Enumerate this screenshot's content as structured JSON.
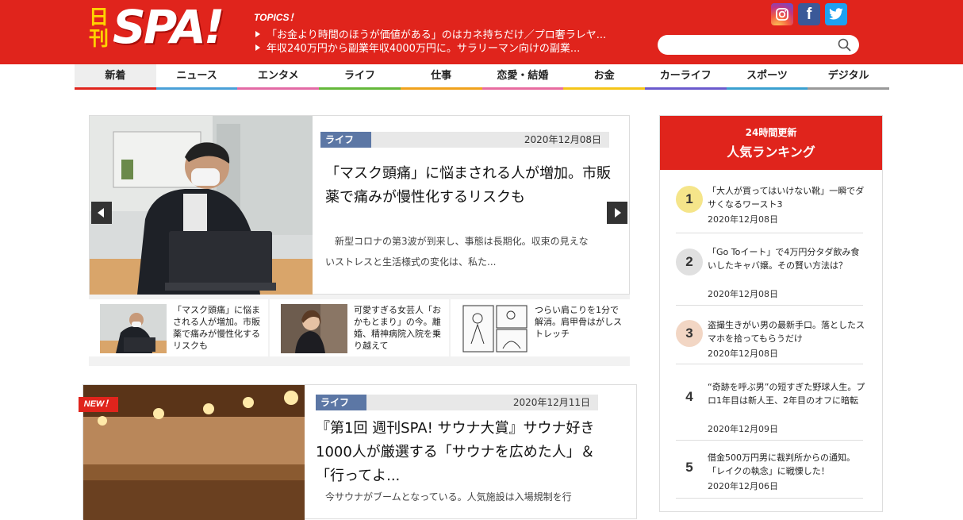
{
  "header": {
    "logo_kanji": "日刊",
    "logo_text": "SPA!",
    "topics_label": "TOPICS！",
    "topics": [
      "「お金より時間のほうが価値がある」のはカネ持ちだけ／プロ奢ラレヤ...",
      "年収240万円から副業年収4000万円に。サラリーマン向けの副業..."
    ],
    "search_placeholder": "",
    "social": [
      "instagram-icon",
      "facebook-icon",
      "twitter-icon"
    ]
  },
  "nav": {
    "items": [
      "新着",
      "ニュース",
      "エンタメ",
      "ライフ",
      "仕事",
      "恋愛・結婚",
      "お金",
      "カーライフ",
      "スポーツ",
      "デジタル"
    ],
    "colors": [
      "#e0241c",
      "#4aa0d8",
      "#e36aa5",
      "#64b83a",
      "#f0a21c",
      "#e86ca0",
      "#f5c518",
      "#6a5acd",
      "#3aa0d0",
      "#999999"
    ]
  },
  "feature": {
    "category": "ライフ",
    "date": "2020年12月08日",
    "headline": "「マスク頭痛」に悩まされる人が増加。市販薬で痛みが慢性化するリスクも",
    "excerpt": "新型コロナの第3波が到来し、事態は長期化。収束の見えないストレスと生活様式の変化は、私た..."
  },
  "thumbs": [
    {
      "text": "「マスク頭痛」に悩まされる人が増加。市販薬で痛みが慢性化するリスクも"
    },
    {
      "text": "可愛すぎる女芸人「おかもとまり」の今。離婚、精神病院入院を乗り越えて"
    },
    {
      "text": "つらい肩こりを1分で解消。肩甲骨はがしストレッチ"
    }
  ],
  "second": {
    "new_badge": "NEW！",
    "category": "ライフ",
    "date": "2020年12月11日",
    "headline": "『第1回 週刊SPA! サウナ大賞』サウナ好き1000人が厳選する「サウナを広めた人」＆「行ってよ...",
    "excerpt": "今サウナがブームとなっている。人気施設は入場規制を行"
  },
  "ranking": {
    "subtitle": "24時間更新",
    "title": "人気ランキング",
    "items": [
      {
        "num": "1",
        "title": "「大人が買ってはいけない靴」一瞬でダサくなるワースト3",
        "date": "2020年12月08日"
      },
      {
        "num": "2",
        "title": "「Go Toイート」で4万円分タダ飲み食いしたキャバ嬢。その賢い方法は？",
        "date": "2020年12月08日"
      },
      {
        "num": "3",
        "title": "盗撮生きがい男の最新手口。落としたスマホを拾ってもらうだけ",
        "date": "2020年12月08日"
      },
      {
        "num": "4",
        "title": "“奇跡を呼ぶ男”の短すぎた野球人生。プロ1年目は新人王、2年目のオフに暗転",
        "date": "2020年12月09日"
      },
      {
        "num": "5",
        "title": "借金500万円男に裁判所からの通知。「レイクの執念」に戦慄した！",
        "date": "2020年12月06日"
      }
    ]
  }
}
